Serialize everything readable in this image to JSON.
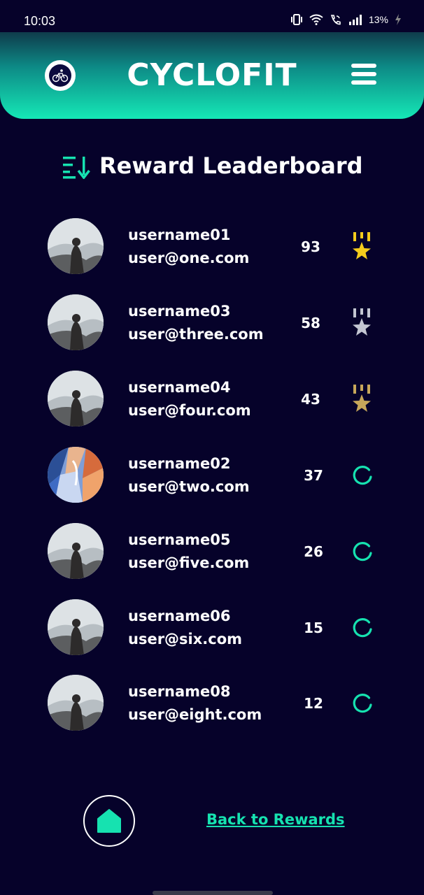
{
  "status_bar": {
    "time": "10:03",
    "battery": "13%",
    "icons": [
      "vibrate-icon",
      "wifi-icon",
      "wifi-call-icon",
      "signal-icon",
      "battery-charging-icon"
    ]
  },
  "header": {
    "title": "CYCLOFIT",
    "logo_icon": "cyclist-logo-icon",
    "menu_icon": "hamburger-menu-icon"
  },
  "page": {
    "title": "Reward Leaderboard",
    "title_icon": "sort-descending-icon"
  },
  "colors": {
    "background": "#06022a",
    "accent": "#16e2b0",
    "gold": "#f5cc1c",
    "silver": "#c3c6d2",
    "bronze": "#c7a75a"
  },
  "leaderboard": [
    {
      "username": "username01",
      "email": "user@one.com",
      "points": "93",
      "badge": "gold-medal-icon",
      "avatar": "photo-avatar"
    },
    {
      "username": "username03",
      "email": "user@three.com",
      "points": "58",
      "badge": "silver-medal-icon",
      "avatar": "photo-avatar"
    },
    {
      "username": "username04",
      "email": "user@four.com",
      "points": "43",
      "badge": "bronze-medal-icon",
      "avatar": "photo-avatar"
    },
    {
      "username": "username02",
      "email": "user@two.com",
      "points": "37",
      "badge": "loading-spinner-icon",
      "avatar": "abstract-paint-avatar"
    },
    {
      "username": "username05",
      "email": "user@five.com",
      "points": "26",
      "badge": "loading-spinner-icon",
      "avatar": "photo-avatar"
    },
    {
      "username": "username06",
      "email": "user@six.com",
      "points": "15",
      "badge": "loading-spinner-icon",
      "avatar": "photo-avatar"
    },
    {
      "username": "username08",
      "email": "user@eight.com",
      "points": "12",
      "badge": "loading-spinner-icon",
      "avatar": "photo-avatar"
    }
  ],
  "footer": {
    "home_icon": "home-icon",
    "back_link": "Back to Rewards"
  }
}
